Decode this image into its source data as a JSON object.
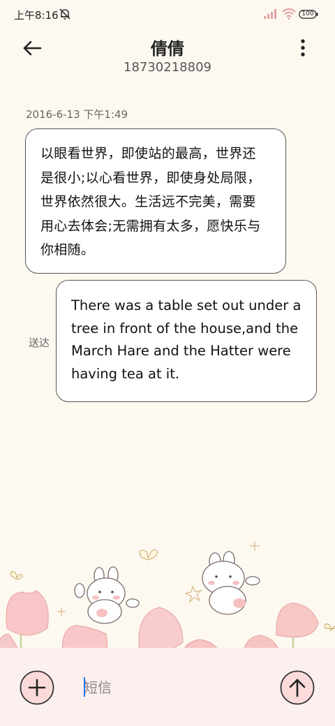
{
  "status_bar": {
    "time": "上午8:16",
    "battery": "100",
    "icons": [
      "mute-icon",
      "signal-icon",
      "wifi-icon",
      "battery-icon"
    ]
  },
  "header": {
    "contact_name": "倩倩",
    "phone_number": "18730218809",
    "icons": [
      "back-arrow-icon",
      "more-vertical-icon"
    ]
  },
  "conversation": {
    "date": "2016-6-13 下午1:49",
    "messages": [
      {
        "direction": "incoming",
        "lines": [
          "以眼看世界，即使站的最高，世界还",
          "是很小;以心看世界，即使身处局限，",
          "世界依然很大。生活远不完美，需要",
          "用心去体会;无需拥有太多，愿快乐与",
          "你相随。"
        ]
      },
      {
        "direction": "outgoing",
        "status": "送达",
        "lines": [
          "There was a table set out under a",
          "tree in front of the house,and the",
          "March Hare and the Hatter were",
          "having tea at it."
        ]
      }
    ]
  },
  "composer": {
    "placeholder": "短信",
    "value": "",
    "icons": [
      "plus-icon",
      "send-arrow-icon"
    ]
  },
  "colors": {
    "background": "#fdf9f1",
    "bubble": "#ffffff",
    "bubble_border": "#555555",
    "bottom_bar": "#fcf0ef",
    "caret": "#1a73e8",
    "decor_pink": "#f7c5c5"
  }
}
